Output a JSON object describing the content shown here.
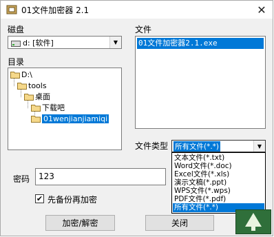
{
  "window": {
    "title": "01文件加密器 2.1",
    "close_glyph": "✕"
  },
  "drive": {
    "label": "磁盘",
    "value": "d: [软件]",
    "arrow": "▼"
  },
  "directory": {
    "label": "目录",
    "nodes": [
      "D:\\",
      "tools",
      "桌面",
      "下载吧",
      "01wenjianjiamiqi"
    ],
    "selected": "01wenjianjiamiqi"
  },
  "files": {
    "label": "文件",
    "items": [
      "01文件加密器2.1.exe"
    ]
  },
  "filetype": {
    "label": "文件类型",
    "value": "所有文件(*.*)",
    "arrow": "▼",
    "options": [
      "文本文件(*.txt)",
      "Word文件(*.doc)",
      "Excel文件(*.xls)",
      "演示文稿(*.ppt)",
      "WPS文件(*.wps)",
      "PDF文件(*.pdf)",
      "所有文件(*.*)"
    ],
    "selected_option": "所有文件(*.*)"
  },
  "password": {
    "label": "密码",
    "value": "123"
  },
  "backup": {
    "label": "先备份再加密",
    "checked": true,
    "check_glyph": "✔"
  },
  "buttons": {
    "encrypt": "加密/解密",
    "close": "关闭"
  },
  "colors": {
    "selection": "#0078d7",
    "window_bg": "#f0f0f0"
  }
}
